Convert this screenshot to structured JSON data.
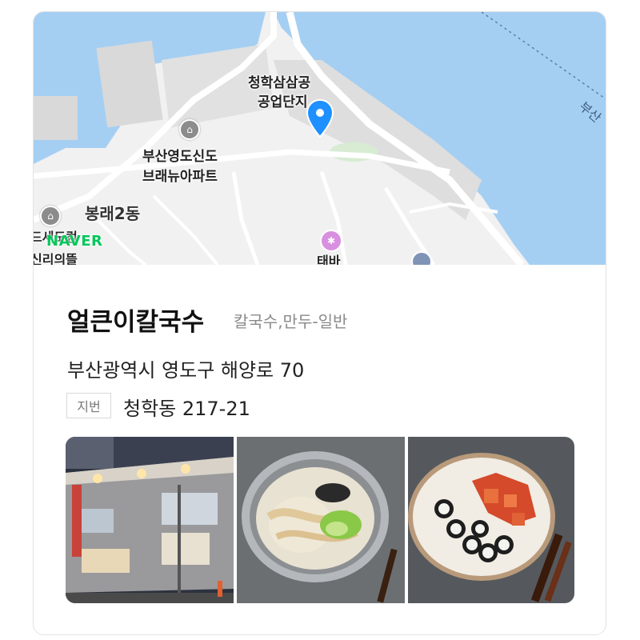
{
  "place": {
    "name": "얼큰이칼국수",
    "category": "칼국수,만두-일반",
    "road_address": "부산광역시 영도구 해양로 70",
    "jibun_badge": "지번",
    "jibun_address": "청학동 217-21"
  },
  "map": {
    "brand": "NAVER",
    "labels": {
      "industrial_complex": [
        "청학삼삼공",
        "공업단지"
      ],
      "apartment": [
        "부산영도신도",
        "브래뉴아파트"
      ],
      "district": "봉래2동",
      "left_edge": [
        "드세도컴",
        "신리의뜰"
      ],
      "right_edge": "부산",
      "bottom_poi": "태바"
    },
    "colors": {
      "water": "#a5cff2",
      "land": "#f1f1f1",
      "marker": "#1e90ff",
      "brand": "#03c75a"
    }
  },
  "photos": [
    {
      "alt": "restaurant-exterior"
    },
    {
      "alt": "kalguksu-bowl"
    },
    {
      "alt": "gimbap-and-kimchi-plate"
    }
  ]
}
